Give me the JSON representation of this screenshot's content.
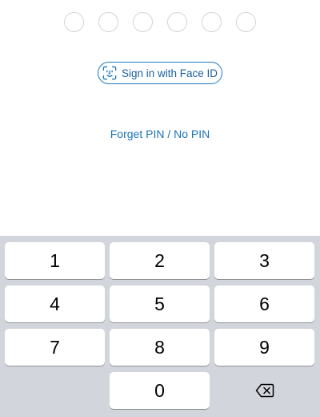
{
  "pin": {
    "length": 6,
    "filled": 0
  },
  "face_id_button": {
    "label": "Sign in with Face ID",
    "icon": "face-id-icon"
  },
  "forget_pin_link": {
    "label": "Forget PIN / No PIN"
  },
  "keypad": {
    "keys": [
      "1",
      "2",
      "3",
      "4",
      "5",
      "6",
      "7",
      "8",
      "9",
      "0"
    ],
    "backspace_icon": "backspace-icon"
  },
  "colors": {
    "accent": "#1b7ac0",
    "keypad_background": "#d2d5db",
    "key_background": "#ffffff",
    "dot_border": "#d0d4d9"
  }
}
